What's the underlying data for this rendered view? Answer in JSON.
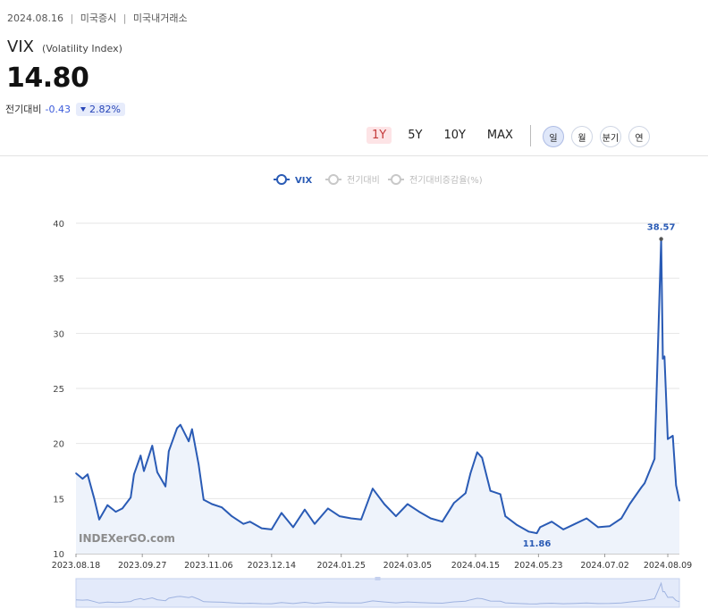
{
  "header": {
    "date": "2024.08.16",
    "market": "미국증시",
    "exchange": "미국내거래소",
    "separator": "|"
  },
  "ticker": {
    "symbol": "VIX",
    "name": "(Volatility Index)"
  },
  "price": {
    "value": "14.80"
  },
  "change": {
    "label": "전기대비",
    "value": "-0.43",
    "percent": "2.82%",
    "direction": "down"
  },
  "periods": [
    {
      "label": "1Y",
      "active": true
    },
    {
      "label": "5Y",
      "active": false
    },
    {
      "label": "10Y",
      "active": false
    },
    {
      "label": "MAX",
      "active": false
    }
  ],
  "frequencies": [
    {
      "label": "일",
      "active": true
    },
    {
      "label": "월",
      "active": false
    },
    {
      "label": "분기",
      "active": false
    },
    {
      "label": "연",
      "active": false
    }
  ],
  "legend": [
    {
      "label": "VIX",
      "active": true
    },
    {
      "label": "전기대비",
      "active": false
    },
    {
      "label": "전기대비증감율(%)",
      "active": false
    }
  ],
  "watermark": "INDEXerGO.com",
  "colors": {
    "line": "#2a5bb5",
    "area": "#eef3fb",
    "grid": "#e6e6e6",
    "inactive": "#c8c8c8",
    "up": "#c43a3a",
    "down": "#3b5bdb"
  },
  "chart_data": {
    "type": "area",
    "title": "",
    "xlabel": "",
    "ylabel": "",
    "ylim": [
      10,
      40
    ],
    "yticks": [
      10,
      15,
      20,
      25,
      30,
      35,
      40
    ],
    "xlim": [
      "2023-08-18",
      "2024-08-16"
    ],
    "xticks": [
      "2023.08.18",
      "2023.09.27",
      "2023.11.06",
      "2023.12.14",
      "2024.01.25",
      "2024.03.05",
      "2024.04.15",
      "2024.05.23",
      "2024.07.02",
      "2024.08.09"
    ],
    "grid": true,
    "legend_position": "top-center",
    "series": [
      {
        "name": "VIX",
        "x": [
          "2023-08-18",
          "2023-08-22",
          "2023-08-25",
          "2023-08-29",
          "2023-09-01",
          "2023-09-06",
          "2023-09-11",
          "2023-09-15",
          "2023-09-20",
          "2023-09-22",
          "2023-09-26",
          "2023-09-28",
          "2023-10-03",
          "2023-10-06",
          "2023-10-11",
          "2023-10-13",
          "2023-10-18",
          "2023-10-20",
          "2023-10-25",
          "2023-10-27",
          "2023-10-31",
          "2023-11-03",
          "2023-11-08",
          "2023-11-14",
          "2023-11-20",
          "2023-11-27",
          "2023-12-01",
          "2023-12-08",
          "2023-12-14",
          "2023-12-20",
          "2023-12-27",
          "2024-01-03",
          "2024-01-09",
          "2024-01-17",
          "2024-01-24",
          "2024-01-31",
          "2024-02-06",
          "2024-02-13",
          "2024-02-20",
          "2024-02-27",
          "2024-03-05",
          "2024-03-12",
          "2024-03-19",
          "2024-03-26",
          "2024-04-02",
          "2024-04-09",
          "2024-04-12",
          "2024-04-16",
          "2024-04-19",
          "2024-04-24",
          "2024-04-30",
          "2024-05-03",
          "2024-05-10",
          "2024-05-17",
          "2024-05-22",
          "2024-05-24",
          "2024-05-31",
          "2024-06-07",
          "2024-06-14",
          "2024-06-21",
          "2024-06-28",
          "2024-07-05",
          "2024-07-12",
          "2024-07-17",
          "2024-07-24",
          "2024-07-26",
          "2024-08-01",
          "2024-08-02",
          "2024-08-05",
          "2024-08-06",
          "2024-08-07",
          "2024-08-09",
          "2024-08-12",
          "2024-08-14",
          "2024-08-16"
        ],
        "values": [
          17.3,
          16.8,
          17.2,
          15.0,
          13.1,
          14.4,
          13.8,
          14.1,
          15.1,
          17.2,
          18.9,
          17.5,
          19.8,
          17.4,
          16.1,
          19.3,
          21.4,
          21.7,
          20.2,
          21.3,
          18.1,
          14.9,
          14.5,
          14.2,
          13.4,
          12.7,
          12.9,
          12.3,
          12.2,
          13.7,
          12.4,
          14.0,
          12.7,
          14.1,
          13.4,
          13.2,
          13.1,
          15.9,
          14.5,
          13.4,
          14.5,
          13.8,
          13.2,
          12.9,
          14.6,
          15.5,
          17.3,
          19.2,
          18.7,
          15.7,
          15.4,
          13.4,
          12.6,
          12.0,
          11.86,
          12.4,
          12.9,
          12.2,
          12.7,
          13.2,
          12.4,
          12.5,
          13.2,
          14.5,
          16.0,
          16.4,
          18.6,
          23.4,
          38.57,
          27.7,
          27.9,
          20.4,
          20.7,
          16.2,
          14.8
        ]
      }
    ],
    "annotations": [
      {
        "text": "38.57",
        "x": "2024-08-05",
        "y": 38.57
      },
      {
        "text": "11.86",
        "x": "2024-05-22",
        "y": 11.86
      }
    ]
  }
}
